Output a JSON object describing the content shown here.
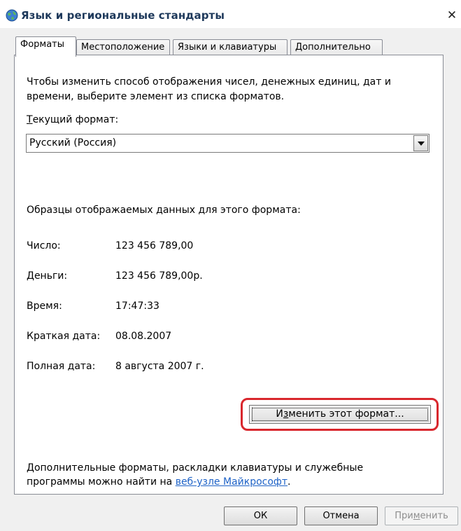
{
  "window": {
    "title": "Язык и региональные стандарты",
    "close_glyph": "✕",
    "icon": "globe-icon"
  },
  "tabs": [
    {
      "label": "Форматы",
      "active": true
    },
    {
      "label": "Местоположение",
      "active": false
    },
    {
      "label": "Языки и клавиатуры",
      "active": false
    },
    {
      "label": "Дополнительно",
      "active": false
    }
  ],
  "formats": {
    "intro": "Чтобы изменить способ отображения чисел, денежных единиц, дат и времени, выберите элемент из списка форматов.",
    "current_format_label_accel": "Т",
    "current_format_label_rest": "екущий формат:",
    "current_format_value": "Русский (Россия)",
    "samples_heading": "Образцы отображаемых данных для этого формата:",
    "samples": [
      {
        "label": "Число:",
        "value": "123 456 789,00"
      },
      {
        "label": "Деньги:",
        "value": "123 456 789,00р."
      },
      {
        "label": "Время:",
        "value": "17:47:33"
      },
      {
        "label": "Краткая дата:",
        "value": "08.08.2007"
      },
      {
        "label": "Полная дата:",
        "value": "8 августа 2007 г."
      }
    ],
    "change_button_pre": "И",
    "change_button_accel": "з",
    "change_button_post": "менить этот формат...",
    "bottom_text_1": "Дополнительные форматы, раскладки клавиатуры и служебные",
    "bottom_text_2": "программы можно найти на ",
    "link_text": "веб-узле Майкрософт",
    "bottom_text_end": "."
  },
  "buttons": {
    "ok": "ОК",
    "cancel": "Отмена",
    "apply_pre": "При",
    "apply_accel": "м",
    "apply_post": "енить"
  },
  "colors": {
    "highlight": "#d9272d",
    "link": "#1f63c7"
  }
}
